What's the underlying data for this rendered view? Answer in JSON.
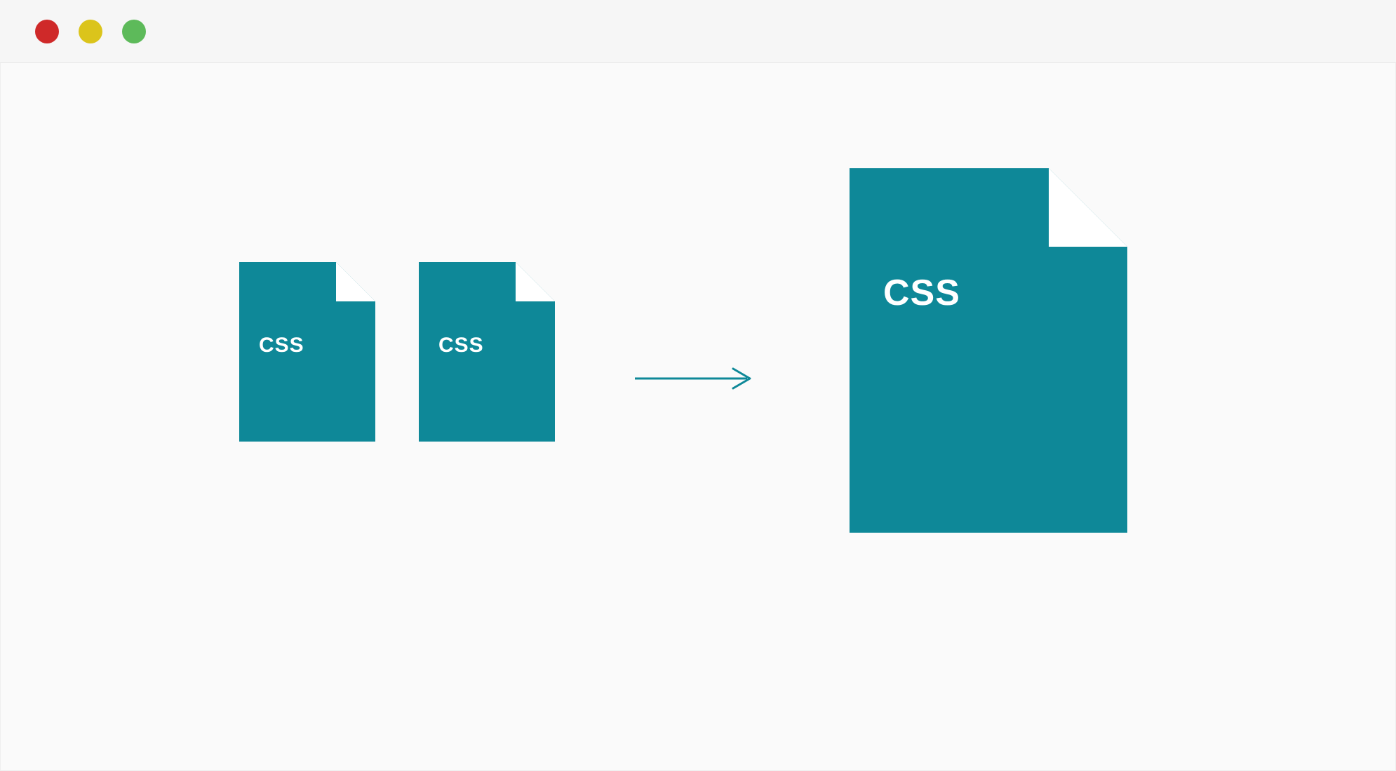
{
  "colors": {
    "file_fill": "#0e8898",
    "background": "#fafafa",
    "titlebar": "#f6f6f6",
    "dot_red": "#cf2929",
    "dot_yellow": "#dbc41b",
    "dot_green": "#5dba5a"
  },
  "files": {
    "small_1_label": "CSS",
    "small_2_label": "CSS",
    "large_label": "CSS"
  },
  "diagram": {
    "concept": "Two CSS files combine into one larger CSS file"
  }
}
